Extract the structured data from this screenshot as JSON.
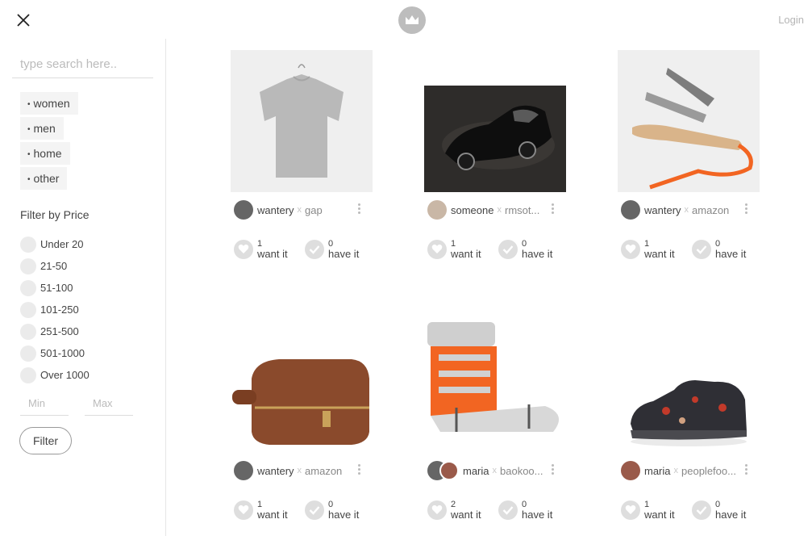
{
  "header": {
    "login_label": "Login"
  },
  "sidebar": {
    "search_placeholder": "type search here..",
    "categories": [
      {
        "label": "women"
      },
      {
        "label": "men"
      },
      {
        "label": "home"
      },
      {
        "label": "other"
      }
    ],
    "filter_title": "Filter by Price",
    "price_ranges": [
      "Under 20",
      "21-50",
      "51-100",
      "101-250",
      "251-500",
      "501-1000",
      "Over 1000"
    ],
    "min_placeholder": "Min",
    "max_placeholder": "Max",
    "filter_button": "Filter"
  },
  "products": [
    {
      "user": "wantery",
      "store": "gap",
      "want_count": "1",
      "want_label": "want it",
      "have_count": "0",
      "have_label": "have it"
    },
    {
      "user": "someone",
      "store": "rmsot...",
      "want_count": "1",
      "want_label": "want it",
      "have_count": "0",
      "have_label": "have it"
    },
    {
      "user": "wantery",
      "store": "amazon",
      "want_count": "1",
      "want_label": "want it",
      "have_count": "0",
      "have_label": "have it"
    },
    {
      "user": "wantery",
      "store": "amazon",
      "want_count": "1",
      "want_label": "want it",
      "have_count": "0",
      "have_label": "have it"
    },
    {
      "user": "maria",
      "store": "baokoo...",
      "want_count": "2",
      "want_label": "want it",
      "have_count": "0",
      "have_label": "have it"
    },
    {
      "user": "maria",
      "store": "peoplefoo...",
      "want_count": "1",
      "want_label": "want it",
      "have_count": "0",
      "have_label": "have it"
    }
  ],
  "product_sep": "x",
  "colors": {
    "accent": "#f26522",
    "icon_gray": "#dedede",
    "text": "#444444"
  }
}
